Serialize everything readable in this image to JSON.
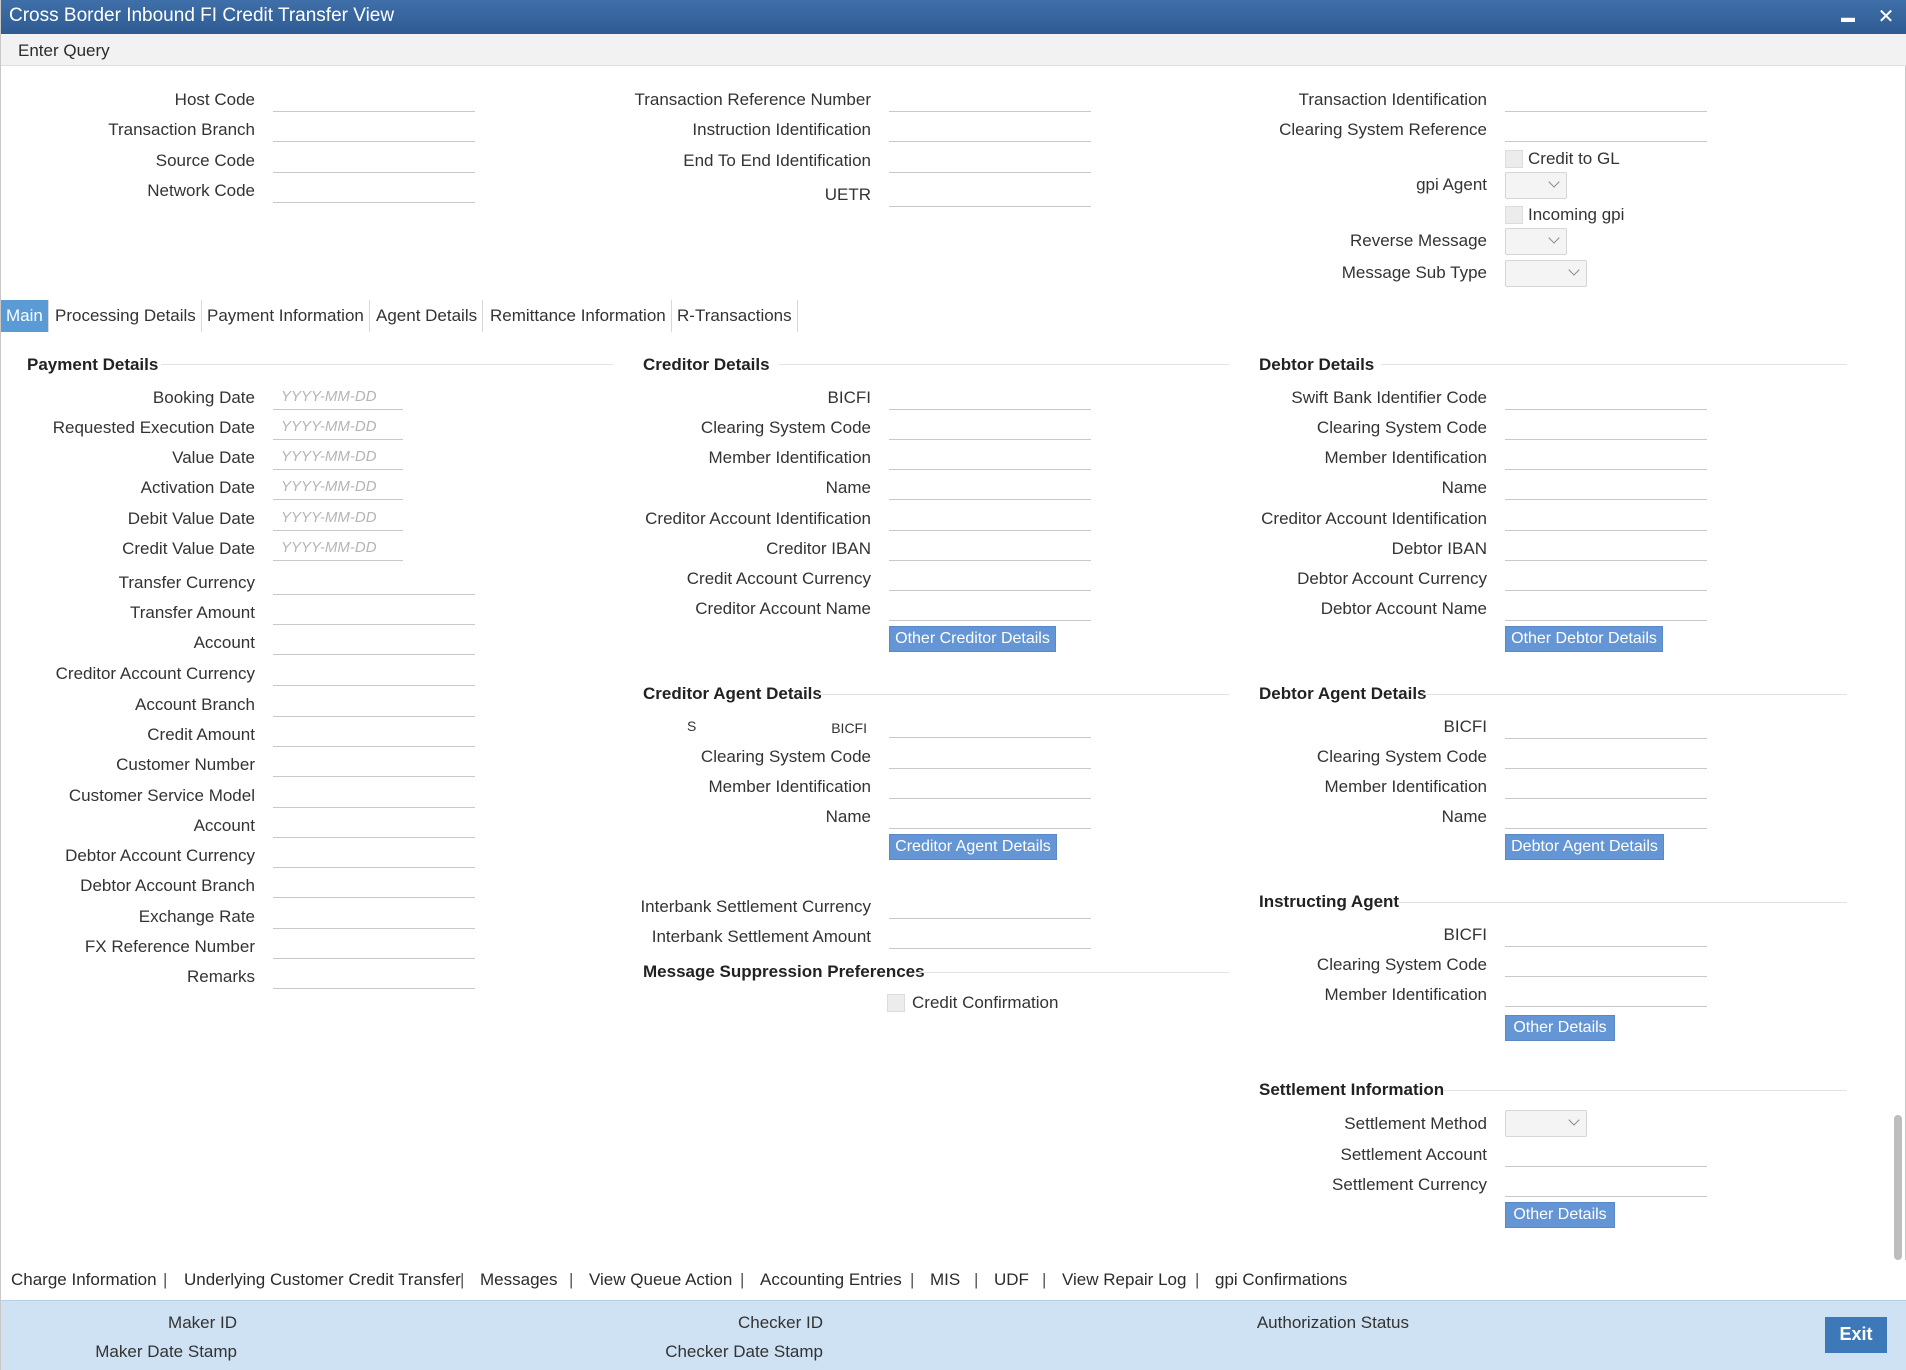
{
  "window": {
    "title": "Cross Border Inbound FI Credit Transfer View",
    "minimize": "▬",
    "close": "✕"
  },
  "menu": {
    "enter_query": "Enter Query"
  },
  "header": {
    "host_code": "Host Code",
    "transaction_branch": "Transaction Branch",
    "source_code": "Source Code",
    "network_code": "Network Code",
    "transaction_reference_number": "Transaction Reference Number",
    "instruction_identification": "Instruction Identification",
    "end_to_end_identification": "End To End Identification",
    "uetr": "UETR",
    "transaction_identification": "Transaction Identification",
    "clearing_system_reference": "Clearing System Reference",
    "credit_to_gl": "Credit to GL",
    "gpi_agent": "gpi Agent",
    "incoming_gpi": "Incoming gpi",
    "reverse_message": "Reverse Message",
    "message_sub_type": "Message Sub Type"
  },
  "tabs": [
    "Main",
    "Processing Details",
    "Payment Information",
    "Agent Details",
    "Remittance Information",
    "R-Transactions"
  ],
  "date_placeholder": "YYYY-MM-DD",
  "payment_details": {
    "title": "Payment Details",
    "booking_date": "Booking Date",
    "requested_execution_date": "Requested Execution Date",
    "value_date": "Value Date",
    "activation_date": "Activation Date",
    "debit_value_date": "Debit Value Date",
    "credit_value_date": "Credit Value Date",
    "transfer_currency": "Transfer Currency",
    "transfer_amount": "Transfer Amount",
    "account": "Account",
    "creditor_account_currency": "Creditor Account Currency",
    "account_branch": "Account Branch",
    "credit_amount": "Credit Amount",
    "customer_number": "Customer Number",
    "customer_service_model": "Customer Service Model",
    "account2": "Account",
    "debtor_account_currency": "Debtor Account Currency",
    "debtor_account_branch": "Debtor Account Branch",
    "exchange_rate": "Exchange Rate",
    "fx_reference_number": "FX Reference Number",
    "remarks": "Remarks"
  },
  "creditor_details": {
    "title": "Creditor Details",
    "bicfi": "BICFI",
    "clearing_system_code": "Clearing System Code",
    "member_identification": "Member Identification",
    "name": "Name",
    "creditor_account_identification": "Creditor Account Identification",
    "creditor_iban": "Creditor IBAN",
    "credit_account_currency": "Credit Account Currency",
    "creditor_account_name": "Creditor Account Name",
    "button": "Other Creditor Details"
  },
  "creditor_agent_details": {
    "title": "Creditor Agent Details",
    "stray": "S",
    "bicfi": "BICFI",
    "clearing_system_code": "Clearing System Code",
    "member_identification": "Member Identification",
    "name": "Name",
    "button": "Creditor Agent Details"
  },
  "interbank": {
    "settlement_currency": "Interbank Settlement Currency",
    "settlement_amount": "Interbank Settlement Amount"
  },
  "message_suppression": {
    "title": "Message Suppression Preferences",
    "credit_confirmation": "Credit Confirmation"
  },
  "debtor_details": {
    "title": "Debtor Details",
    "swift_bank_identifier_code": "Swift Bank Identifier Code",
    "clearing_system_code": "Clearing System Code",
    "member_identification": "Member Identification",
    "name": "Name",
    "creditor_account_identification": "Creditor Account Identification",
    "debtor_iban": "Debtor IBAN",
    "debtor_account_currency": "Debtor Account Currency",
    "debtor_account_name": "Debtor Account Name",
    "button": "Other Debtor Details"
  },
  "debtor_agent_details": {
    "title": "Debtor Agent Details",
    "bicfi": "BICFI",
    "clearing_system_code": "Clearing System Code",
    "member_identification": "Member Identification",
    "name": "Name",
    "button": "Debtor Agent Details"
  },
  "instructing_agent": {
    "title": "Instructing Agent",
    "bicfi": "BICFI",
    "clearing_system_code": "Clearing System Code",
    "member_identification": "Member Identification",
    "button": "Other Details"
  },
  "settlement_information": {
    "title": "Settlement Information",
    "settlement_method": "Settlement Method",
    "settlement_account": "Settlement Account",
    "settlement_currency": "Settlement Currency",
    "button": "Other Details"
  },
  "bottom_links": [
    "Charge Information",
    "Underlying Customer Credit Transfer",
    "Messages",
    "View Queue Action",
    "Accounting Entries",
    "MIS",
    "UDF",
    "View Repair Log",
    "gpi Confirmations"
  ],
  "bottom_separator": "|",
  "footer": {
    "maker_id": "Maker ID",
    "maker_date_stamp": "Maker Date Stamp",
    "checker_id": "Checker ID",
    "checker_date_stamp": "Checker Date Stamp",
    "authorization_status": "Authorization Status",
    "exit": "Exit"
  }
}
